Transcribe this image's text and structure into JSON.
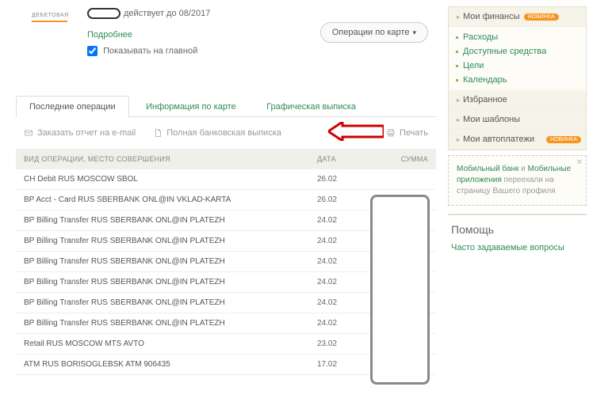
{
  "card": {
    "type_label": "ДЕБЕТОВАЯ",
    "expiry_text": "действует до 08/2017",
    "details_label": "Подробнее",
    "show_on_main_label": "Показывать на главной",
    "show_on_main_checked": true,
    "operations_button": "Операции по карте"
  },
  "tabs": [
    {
      "label": "Последние операции",
      "active": true
    },
    {
      "label": "Информация по карте",
      "active": false
    },
    {
      "label": "Графическая выписка",
      "active": false
    }
  ],
  "actions": {
    "order_email": "Заказать отчет на e-mail",
    "full_statement": "Полная банковская выписка",
    "print": "Печать"
  },
  "table": {
    "headers": {
      "op": "ВИД ОПЕРАЦИИ, МЕСТО СОВЕРШЕНИЯ",
      "date": "ДАТА",
      "sum": "СУММА"
    },
    "rows": [
      {
        "op": "CH Debit RUS MOSCOW SBOL",
        "date": "26.02"
      },
      {
        "op": "BP Acct - Card RUS SBERBANK ONL@IN VKLAD-KARTA",
        "date": "26.02"
      },
      {
        "op": "BP Billing Transfer RUS SBERBANK ONL@IN PLATEZH",
        "date": "24.02"
      },
      {
        "op": "BP Billing Transfer RUS SBERBANK ONL@IN PLATEZH",
        "date": "24.02"
      },
      {
        "op": "BP Billing Transfer RUS SBERBANK ONL@IN PLATEZH",
        "date": "24.02"
      },
      {
        "op": "BP Billing Transfer RUS SBERBANK ONL@IN PLATEZH",
        "date": "24.02"
      },
      {
        "op": "BP Billing Transfer RUS SBERBANK ONL@IN PLATEZH",
        "date": "24.02"
      },
      {
        "op": "BP Billing Transfer RUS SBERBANK ONL@IN PLATEZH",
        "date": "24.02"
      },
      {
        "op": "Retail RUS MOSCOW MTS AVTO",
        "date": "23.02"
      },
      {
        "op": "ATM RUS BORISOGLEBSK ATM 906435",
        "date": "17.02"
      }
    ]
  },
  "sidebar": {
    "finances": {
      "title": "Мои финансы",
      "badge": "НОВИНКА",
      "items": [
        "Расходы",
        "Доступные средства",
        "Цели",
        "Календарь"
      ]
    },
    "favorites": "Избранное",
    "templates": "Мои шаблоны",
    "autopay": {
      "title": "Мои автоплатежи",
      "badge": "НОВИНКА"
    },
    "notice": {
      "part1": "Мобильный банк",
      "and": " и ",
      "part2": "Мобильные приложения",
      "rest": " переехали на страницу Вашего профиля"
    },
    "help": {
      "title": "Помощь",
      "link": "Часто задаваемые вопросы"
    }
  }
}
